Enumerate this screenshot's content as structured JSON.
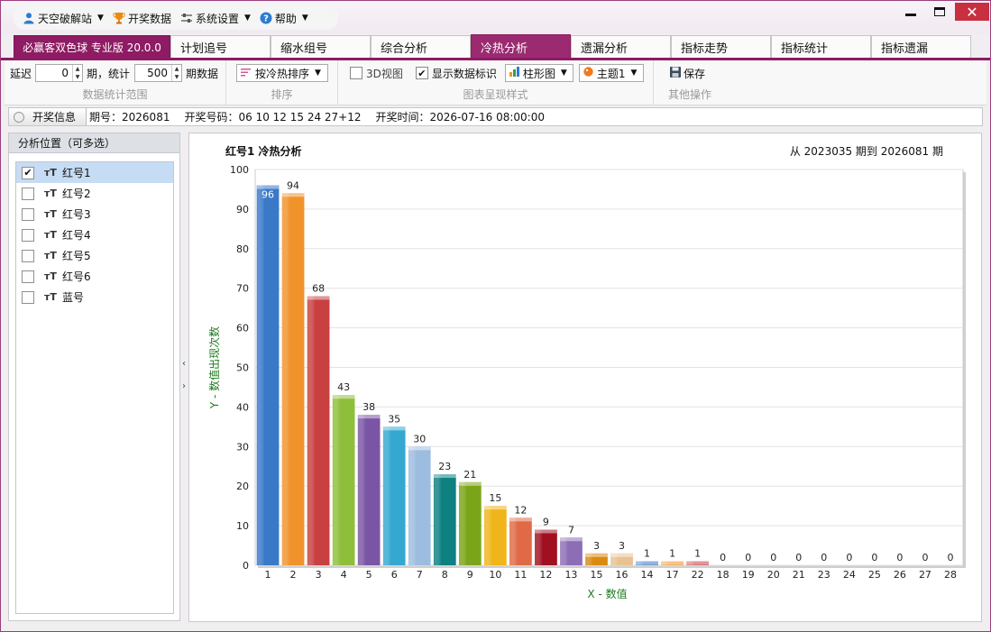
{
  "menu": {
    "items": [
      {
        "label": "天空破解站",
        "icon": "user-icon"
      },
      {
        "label": "开奖数据",
        "icon": "trophy-icon"
      },
      {
        "label": "系统设置",
        "icon": "settings-icon"
      },
      {
        "label": "帮助",
        "icon": "help-icon"
      }
    ]
  },
  "window_controls": {
    "min": "minimize-icon",
    "max": "maximize-icon",
    "close": "close-icon"
  },
  "tabs": {
    "brand": "必赢客双色球 专业版 20.0.0",
    "items": [
      "计划追号",
      "缩水组号",
      "综合分析",
      "冷热分析",
      "遗漏分析",
      "指标走势",
      "指标统计",
      "指标遗漏"
    ],
    "active": "冷热分析"
  },
  "toolbar": {
    "range": {
      "delay_label": "延迟",
      "delay_value": "0",
      "period_label": "期，统计",
      "count_value": "500",
      "count_label": "期数据",
      "group_label": "数据统计范围"
    },
    "sort": {
      "combo": "按冷热排序",
      "group_label": "排序"
    },
    "style": {
      "view3d_label": "3D视图",
      "view3d_checked": false,
      "show_labels_label": "显示数据标识",
      "show_labels_checked": true,
      "chart_type": "柱形图",
      "theme": "主题1",
      "group_label": "图表呈现样式"
    },
    "other": {
      "save_label": "保存",
      "group_label": "其他操作"
    }
  },
  "infobar": {
    "button": "开奖信息",
    "issue_label": "期号：",
    "issue": "2026081",
    "numbers_label": "开奖号码：",
    "numbers": "06 10 12 15 24 27+12",
    "time_label": "开奖时间：",
    "time": "2026-07-16 08:00:00"
  },
  "leftpanel": {
    "header": "分析位置（可多选）",
    "items": [
      {
        "label": "红号1",
        "checked": true,
        "selected": true
      },
      {
        "label": "红号2",
        "checked": false,
        "selected": false
      },
      {
        "label": "红号3",
        "checked": false,
        "selected": false
      },
      {
        "label": "红号4",
        "checked": false,
        "selected": false
      },
      {
        "label": "红号5",
        "checked": false,
        "selected": false
      },
      {
        "label": "红号6",
        "checked": false,
        "selected": false
      },
      {
        "label": "蓝号",
        "checked": false,
        "selected": false
      }
    ]
  },
  "chart_data": {
    "type": "bar",
    "title": "红号1 冷热分析",
    "range_text": "从 2023035 期到 2026081 期",
    "xlabel": "X - 数值",
    "ylabel": "Y - 数值出现次数",
    "ylim": [
      0,
      100
    ],
    "yticks": [
      0,
      10,
      20,
      30,
      40,
      50,
      60,
      70,
      80,
      90,
      100
    ],
    "grid": true,
    "categories": [
      "1",
      "2",
      "3",
      "4",
      "5",
      "6",
      "7",
      "8",
      "9",
      "10",
      "11",
      "12",
      "13",
      "15",
      "16",
      "14",
      "17",
      "22",
      "18",
      "19",
      "20",
      "21",
      "23",
      "24",
      "25",
      "26",
      "27",
      "28"
    ],
    "values": [
      96,
      94,
      68,
      43,
      38,
      35,
      30,
      23,
      21,
      15,
      12,
      9,
      7,
      3,
      3,
      1,
      1,
      1,
      0,
      0,
      0,
      0,
      0,
      0,
      0,
      0,
      0,
      0
    ],
    "colors": [
      "#3a78c8",
      "#f0932b",
      "#c84040",
      "#8fbf3a",
      "#7a55a5",
      "#35a8d0",
      "#9dbde0",
      "#0e8080",
      "#7aa518",
      "#f0b51a",
      "#e06a45",
      "#a01020",
      "#8d6db5",
      "#d98a10",
      "#e8c290",
      "#3a78c8",
      "#f0932b",
      "#c84040",
      "#8fbf3a",
      "#7a55a5",
      "#35a8d0",
      "#9dbde0",
      "#0e8080",
      "#7aa518",
      "#f0b51a",
      "#e06a45",
      "#a01020",
      "#8d6db5"
    ]
  }
}
